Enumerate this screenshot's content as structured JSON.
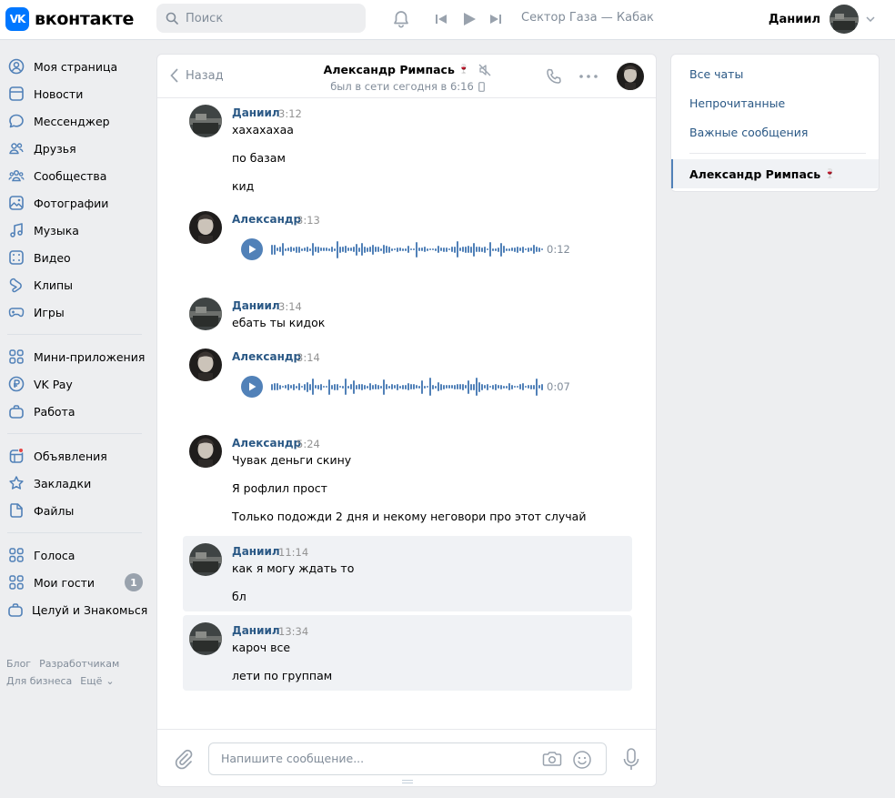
{
  "header": {
    "logo_text": "вконтакте",
    "logo_mark": "VK",
    "search_placeholder": "Поиск",
    "now_playing": "Сектор Газа — Кабак",
    "user_name": "Даниил"
  },
  "sidebar": {
    "groups": [
      [
        {
          "label": "Моя страница",
          "icon": "user-circle-icon"
        },
        {
          "label": "Новости",
          "icon": "newspaper-icon"
        },
        {
          "label": "Мессенджер",
          "icon": "message-icon"
        },
        {
          "label": "Друзья",
          "icon": "friends-icon"
        },
        {
          "label": "Сообщества",
          "icon": "communities-icon"
        },
        {
          "label": "Фотографии",
          "icon": "photo-icon"
        },
        {
          "label": "Музыка",
          "icon": "music-icon"
        },
        {
          "label": "Видео",
          "icon": "video-icon"
        },
        {
          "label": "Клипы",
          "icon": "clips-icon"
        },
        {
          "label": "Игры",
          "icon": "gamepad-icon"
        }
      ],
      [
        {
          "label": "Мини-приложения",
          "icon": "apps-icon"
        },
        {
          "label": "VK Pay",
          "icon": "vkpay-icon"
        },
        {
          "label": "Работа",
          "icon": "briefcase-icon"
        }
      ],
      [
        {
          "label": "Объявления",
          "icon": "classifieds-icon"
        },
        {
          "label": "Закладки",
          "icon": "star-icon"
        },
        {
          "label": "Файлы",
          "icon": "file-icon"
        }
      ],
      [
        {
          "label": "Голоса",
          "icon": "apps-icon"
        },
        {
          "label": "Мои гости",
          "icon": "apps-icon",
          "badge": "1"
        },
        {
          "label": "Целуй и Знакомься",
          "icon": "briefcase-icon"
        }
      ]
    ],
    "footer": {
      "blog": "Блог",
      "developers": "Разработчикам",
      "business": "Для бизнеса",
      "more": "Ещё"
    }
  },
  "chat": {
    "back_label": "Назад",
    "peer_name": "Александр Римпась",
    "peer_emoji": "🍷",
    "peer_status": "был в сети сегодня в 6:16",
    "composer_placeholder": "Напишите сообщение...",
    "messages": [
      {
        "author": "Даниил",
        "time": "3:12",
        "lines": [
          "хахахахаа",
          "по базам",
          "кид"
        ]
      },
      {
        "author": "Александр",
        "time": "3:13",
        "voice_duration": "0:12"
      },
      {
        "author": "Даниил",
        "time": "3:14",
        "lines": [
          "ебать ты кидок"
        ]
      },
      {
        "author": "Александр",
        "time": "3:14",
        "voice_duration": "0:07"
      },
      {
        "author": "Александр",
        "time": "5:24",
        "lines": [
          "Чувак деньги скину",
          "Я рофлил прост",
          "Только подожди 2 дня и некому неговори про этот случай"
        ]
      },
      {
        "author": "Даниил",
        "time": "11:14",
        "lines": [
          "как я могу ждать то",
          "бл"
        ],
        "highlighted": true
      },
      {
        "author": "Даниил",
        "time": "13:34",
        "lines": [
          "кароч все",
          "лети по группам"
        ],
        "highlighted": true
      }
    ]
  },
  "right_panel": {
    "all_chats": "Все чаты",
    "unread": "Непрочитанные",
    "important": "Важные сообщения",
    "active_chat": "Александр Римпась",
    "active_emoji": "🍷"
  },
  "colors": {
    "accent": "#0077ff",
    "link": "#2a5885",
    "voice": "#5181b8",
    "background": "#edeef0"
  }
}
